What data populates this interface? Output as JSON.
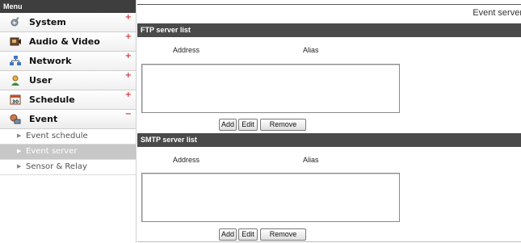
{
  "sidebar": {
    "header": "Menu",
    "items": [
      {
        "label": "System",
        "icon": "wrench-gear-icon",
        "toggle": "+"
      },
      {
        "label": "Audio & Video",
        "icon": "video-icon",
        "toggle": "+"
      },
      {
        "label": "Network",
        "icon": "network-icon",
        "toggle": "+"
      },
      {
        "label": "User",
        "icon": "user-icon",
        "toggle": "+"
      },
      {
        "label": "Schedule",
        "icon": "calendar-icon",
        "toggle": "+"
      },
      {
        "label": "Event",
        "icon": "event-icon",
        "toggle": "−"
      }
    ],
    "event_sub_items": [
      {
        "label": "Event schedule"
      },
      {
        "label": "Event server",
        "active": true
      },
      {
        "label": "Sensor & Relay"
      }
    ]
  },
  "main": {
    "title": "Event server",
    "ftp": {
      "heading": "FTP server list",
      "col_address": "Address",
      "col_alias": "Alias",
      "add": "Add",
      "edit": "Edit",
      "remove": "Remove"
    },
    "smtp": {
      "heading": "SMTP server list",
      "col_address": "Address",
      "col_alias": "Alias",
      "add": "Add",
      "edit": "Edit",
      "remove": "Remove"
    }
  },
  "colors": {
    "header_bg": "#3e3e3e",
    "section_bg": "#4a4a4a",
    "active_sub_bg": "#c7c7c7",
    "toggle": "#d23b3b"
  }
}
